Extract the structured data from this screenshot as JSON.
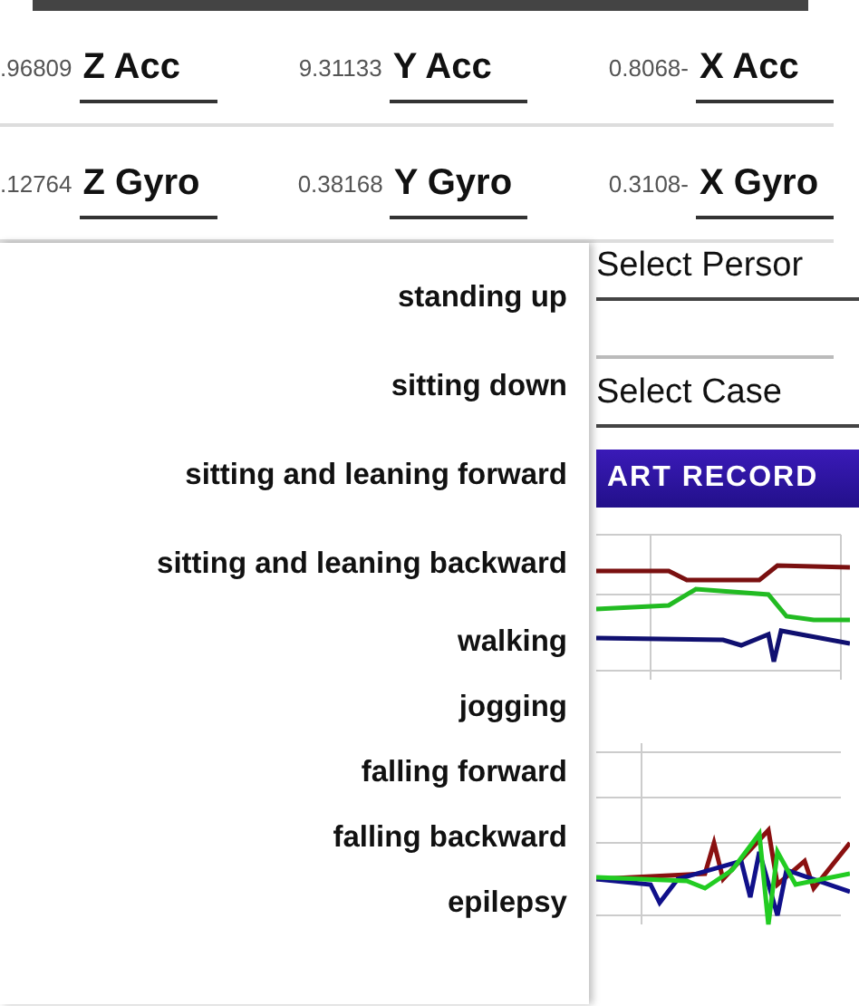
{
  "sensor_rows": [
    [
      {
        "value": ".96809",
        "label": "Z Acc"
      },
      {
        "value": "9.31133",
        "label": "Y Acc"
      },
      {
        "value": "0.8068-",
        "label": "X Acc"
      }
    ],
    [
      {
        "value": ".12764",
        "label": "Z Gyro"
      },
      {
        "value": "0.38168",
        "label": "Y Gyro"
      },
      {
        "value": "0.3108-",
        "label": "X Gyro"
      }
    ]
  ],
  "dropdown": {
    "items": [
      "standing up",
      "sitting down",
      "sitting and leaning forward",
      "sitting and leaning backward",
      "walking",
      "jogging",
      "falling forward",
      "falling backward",
      "epilepsy"
    ]
  },
  "person_select": {
    "placeholder": "Select Persor"
  },
  "case_select": {
    "placeholder": "Select Case"
  },
  "record_button": {
    "label": "ART RECORD"
  }
}
